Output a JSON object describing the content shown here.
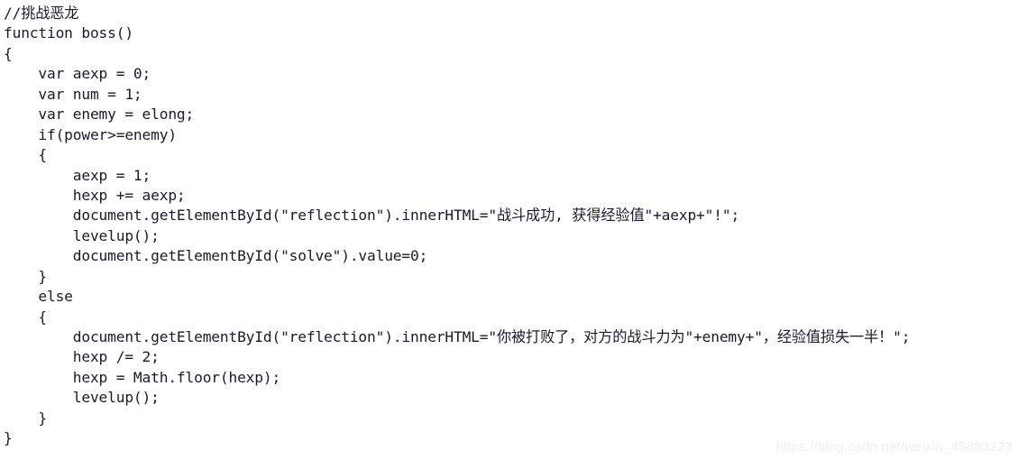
{
  "document": {
    "type": "code-snippet",
    "language": "javascript",
    "background_color": "#ffffff",
    "text_color": "#1a1a2e"
  },
  "code": {
    "lines": [
      "//挑战恶龙",
      "function boss()",
      "{",
      "    var aexp = 0;",
      "    var num = 1;",
      "    var enemy = elong;",
      "    if(power>=enemy)",
      "    {",
      "        aexp = 1;",
      "        hexp += aexp;",
      "        document.getElementById(\"reflection\").innerHTML=\"战斗成功, 获得经验值\"+aexp+\"!\";",
      "        levelup();",
      "        document.getElementById(\"solve\").value=0;",
      "    }",
      "    else",
      "    {",
      "        document.getElementById(\"reflection\").innerHTML=\"你被打败了，对方的战斗力为\"+enemy+\"，经验值损失一半！\";",
      "        hexp /= 2;",
      "        hexp = Math.floor(hexp);",
      "        levelup();",
      "    }",
      "}"
    ]
  },
  "watermark": {
    "text": "https://blog.csdn.net/weixin_45883223",
    "color": "#eceff1"
  }
}
